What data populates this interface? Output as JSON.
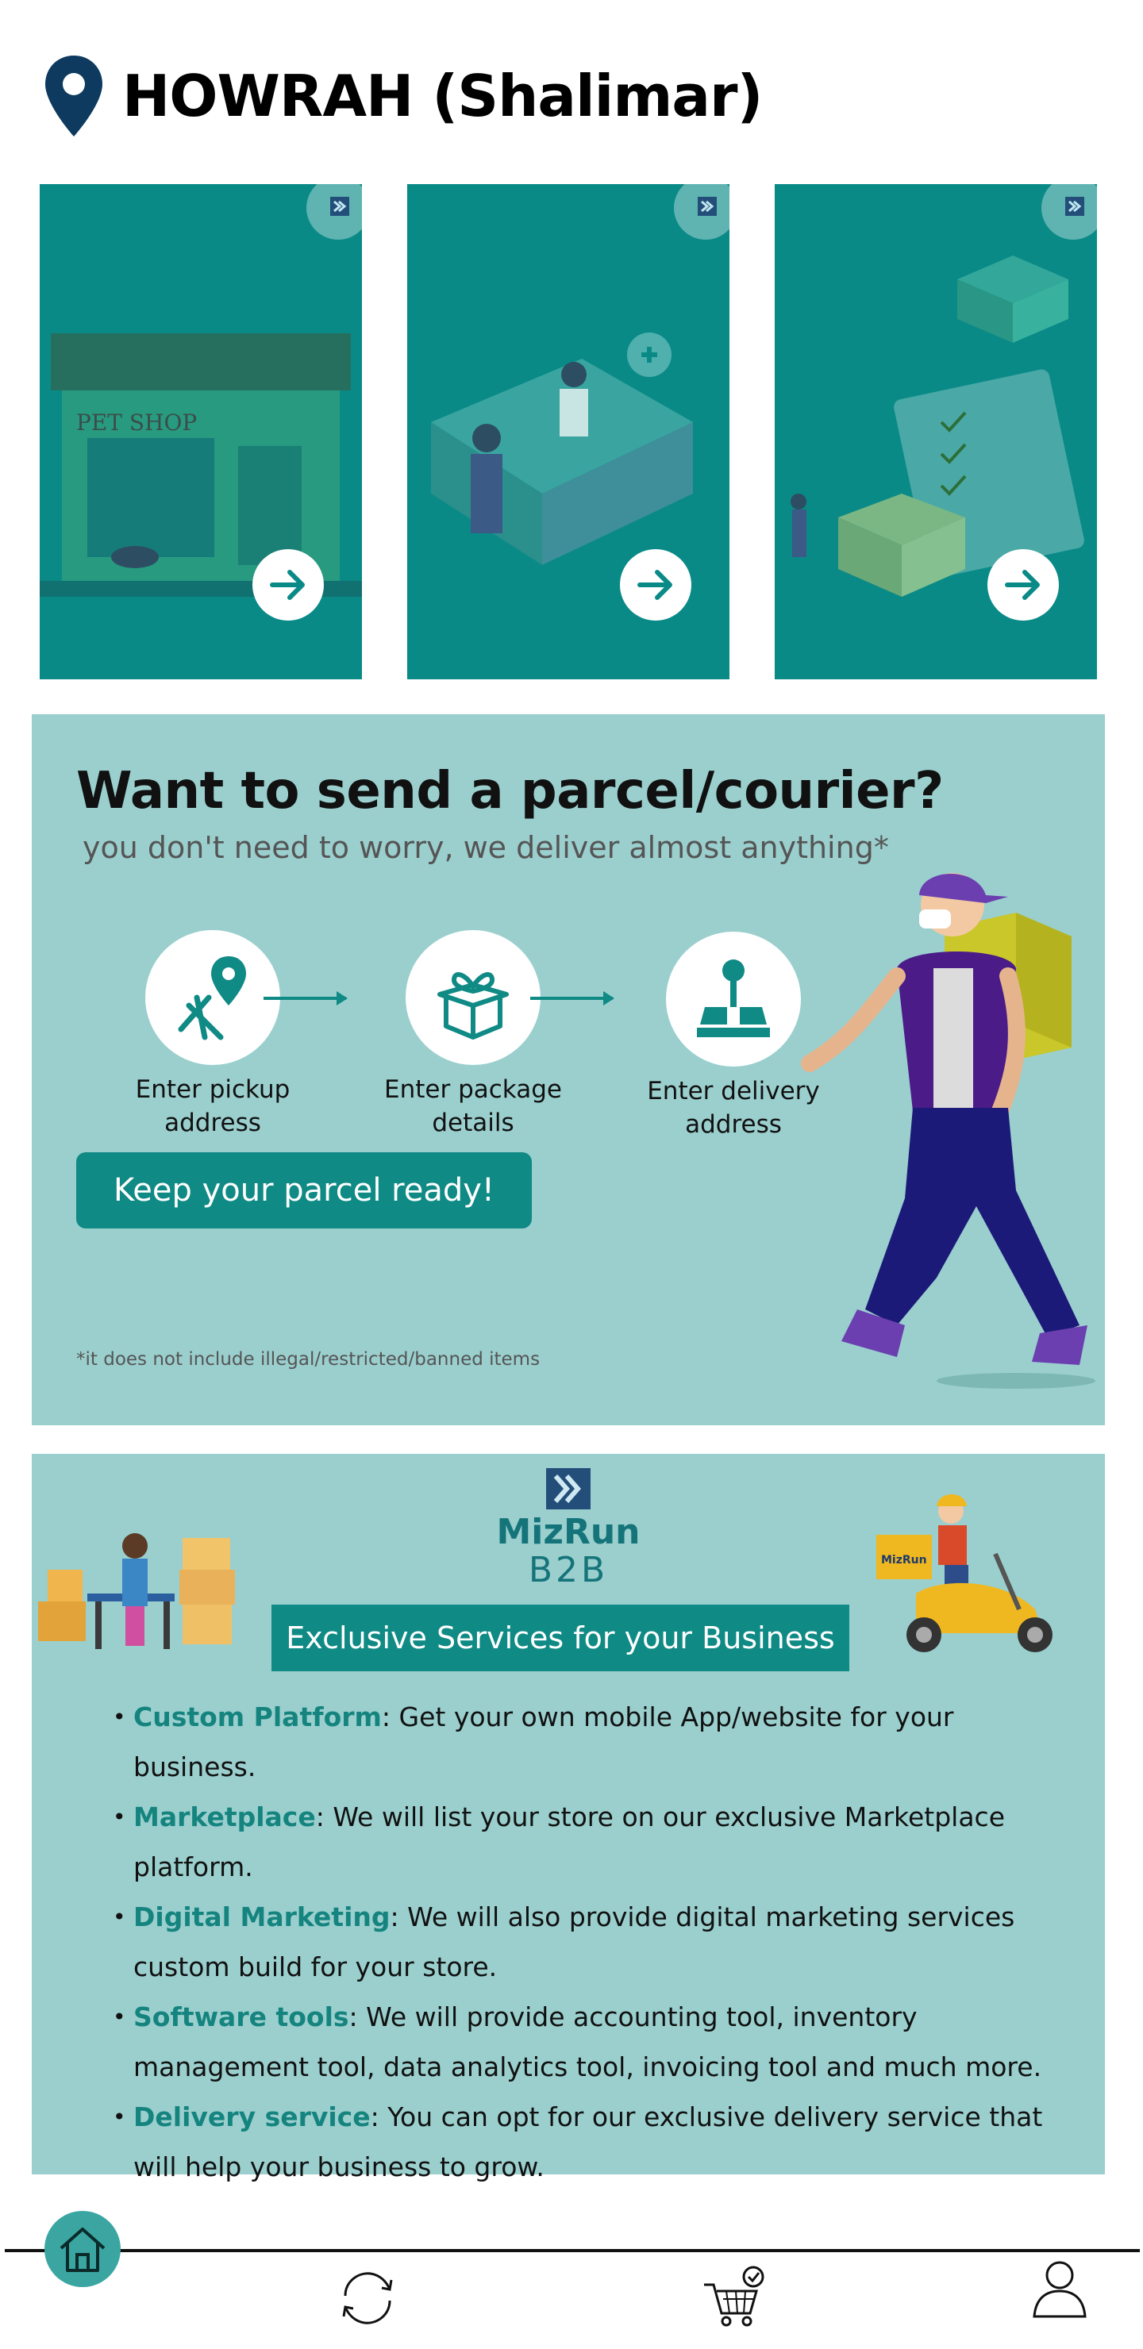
{
  "header": {
    "location": "HOWRAH (Shalimar)",
    "icon": "location-pin-icon"
  },
  "categories": [
    {
      "name": "Pet shop",
      "sign": "PET SHOP",
      "icon": "arrow-right-icon"
    },
    {
      "name": "Pharmacy",
      "icon": "arrow-right-icon"
    },
    {
      "name": "Parcel delivery",
      "icon": "arrow-right-icon"
    }
  ],
  "courier_banner": {
    "title": "Want to send a parcel/courier?",
    "subtitle": "you don't need to worry, we deliver almost anything*",
    "steps": [
      {
        "line1": "Enter pickup",
        "line2": "address",
        "icon": "map-pin-icon"
      },
      {
        "line1": "Enter package",
        "line2": "details",
        "icon": "gift-box-icon"
      },
      {
        "line1": "Enter delivery",
        "line2": "address",
        "icon": "destination-icon"
      }
    ],
    "cta": "Keep your parcel ready!",
    "disclaimer": "*it does not include illegal/restricted/banned items"
  },
  "b2b_banner": {
    "brand": "MizRun",
    "brand_sub": "B2B",
    "scooter_label": "MizRun",
    "heading": "Exclusive Services for your Business",
    "items": [
      {
        "key": "Custom Platform",
        "text": ": Get your own mobile App/website for your business."
      },
      {
        "key": "Marketplace",
        "text": ": We will list your store on our exclusive Marketplace platform."
      },
      {
        "key": "Digital Marketing",
        "text": ": We will also provide digital marketing services custom build for your store."
      },
      {
        "key": "Software tools",
        "text": ": We will provide accounting tool, inventory management tool, data analytics tool, invoicing tool and much more."
      },
      {
        "key": "Delivery service",
        "text": ": You can opt for our exclusive delivery service that will help your business to grow."
      }
    ]
  },
  "bottom_nav": [
    {
      "name": "home",
      "icon": "home-icon",
      "active": true
    },
    {
      "name": "reorder",
      "icon": "refresh-icon"
    },
    {
      "name": "cart",
      "icon": "cart-icon"
    },
    {
      "name": "profile",
      "icon": "user-icon"
    }
  ],
  "colors": {
    "teal_dark": "#0a8a87",
    "teal_light": "#9acfce",
    "brand_teal": "#0f8a85",
    "pin_navy": "#0d3a5e"
  }
}
